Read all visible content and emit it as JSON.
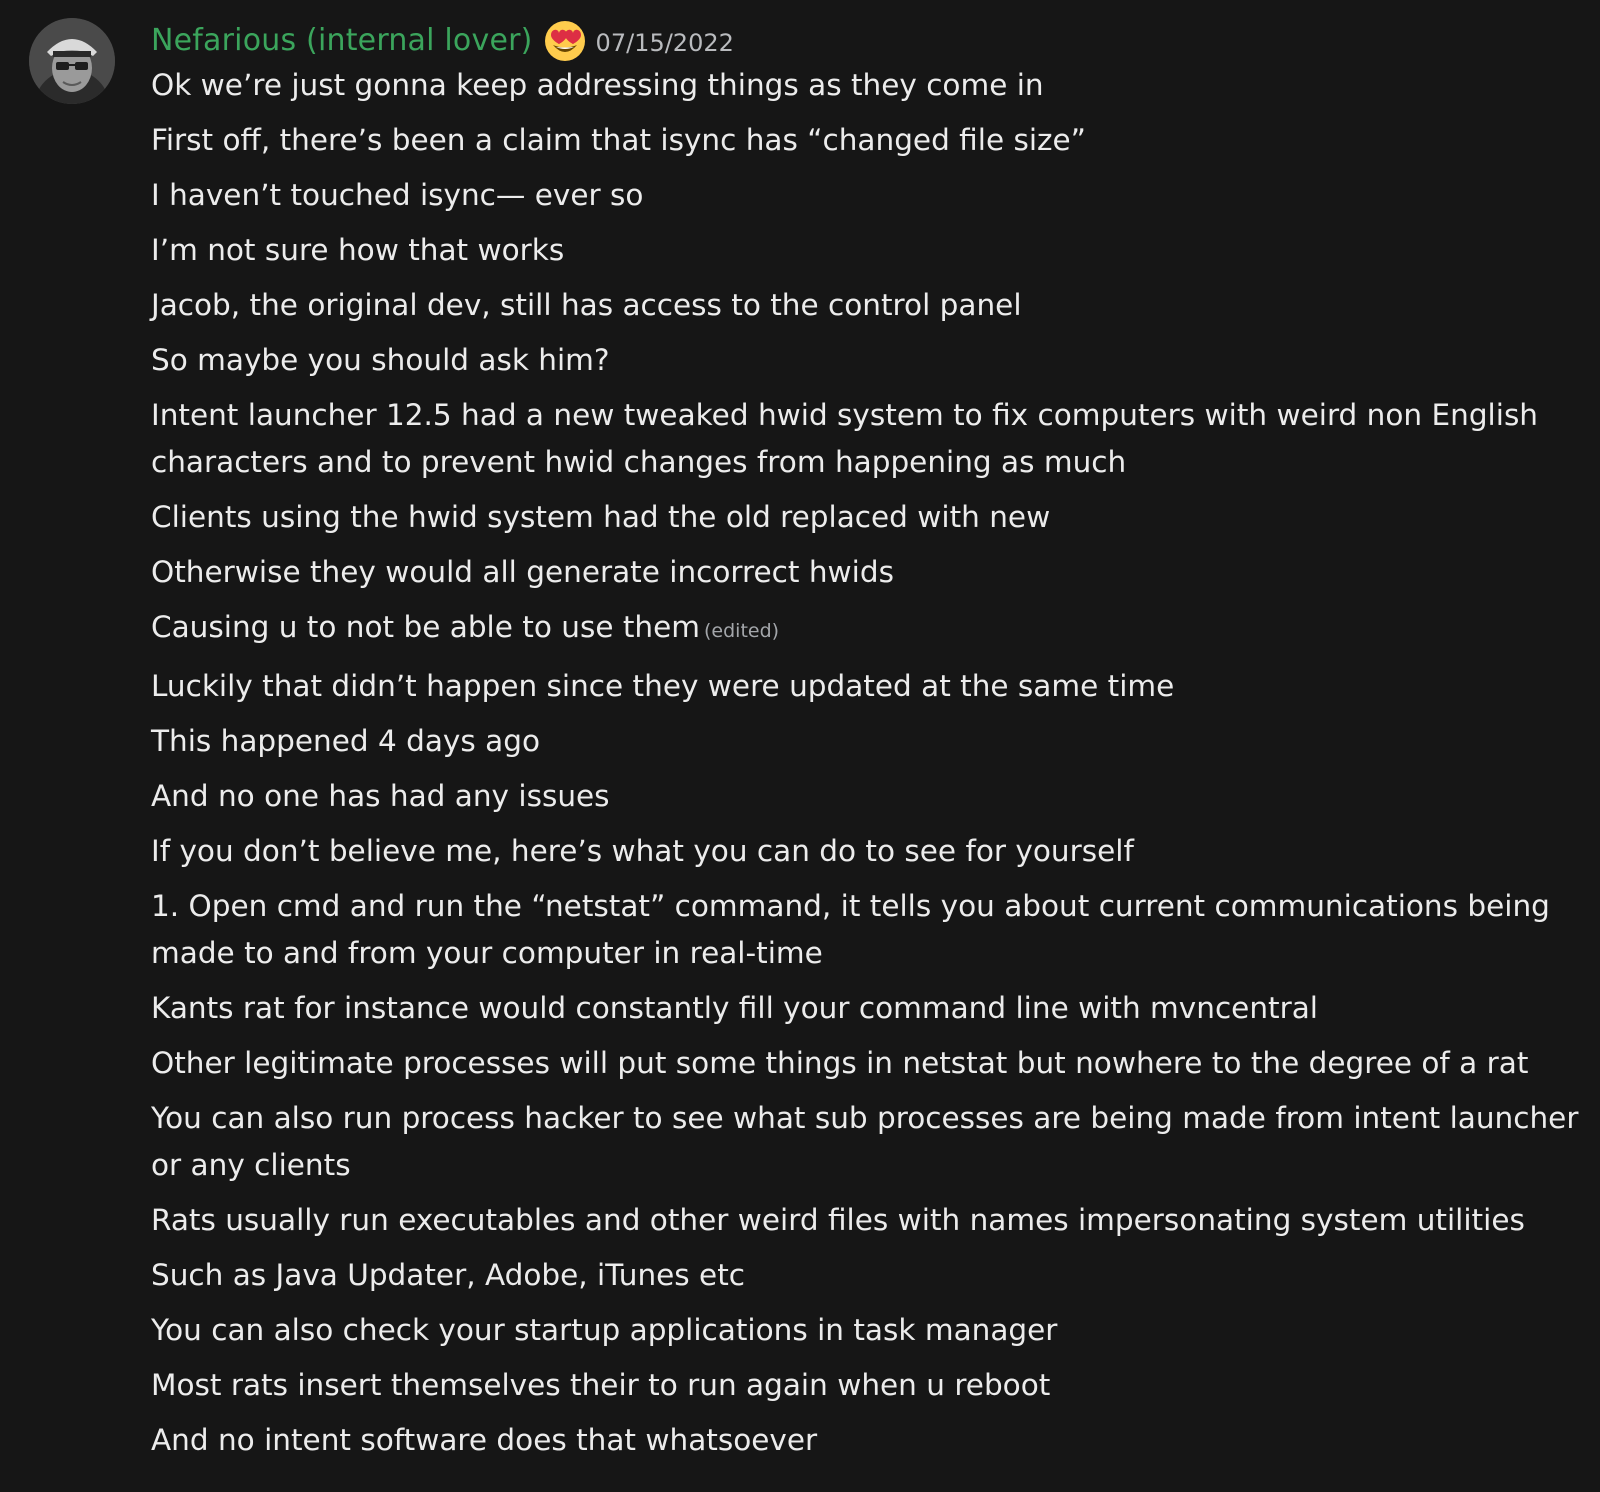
{
  "author": {
    "name": "Nefarious (internal lover)",
    "emoji": "heart-eyes-emoji",
    "timestamp": "07/15/2022",
    "name_color": "#3ba55c"
  },
  "edited_label": "(edited)",
  "messages": [
    {
      "text": "Ok we’re just gonna keep addressing things as they come in"
    },
    {
      "text": "First off, there’s been a claim that isync has “changed file size”"
    },
    {
      "text": "I haven’t touched isync— ever so"
    },
    {
      "text": "I’m not sure how that works"
    },
    {
      "text": "Jacob, the original dev, still has access to the control panel"
    },
    {
      "text": "So maybe you should ask him?"
    },
    {
      "text": "Intent launcher 12.5 had a new tweaked hwid system to fix computers with weird non English characters and to prevent hwid changes from happening as much"
    },
    {
      "text": "Clients using the hwid system had the old replaced with new"
    },
    {
      "text": "Otherwise they would all generate incorrect hwids"
    },
    {
      "text": "Causing u to not be able to use them",
      "edited": true
    },
    {
      "text": "Luckily that didn’t happen since they were updated at the same time"
    },
    {
      "text": "This happened 4 days ago"
    },
    {
      "text": "And no one has had any issues"
    },
    {
      "text": "If you don’t believe me, here’s what you can do to see for yourself"
    },
    {
      "text": "1. Open cmd and run the “netstat” command, it tells you about current communications being made to and from your computer in real-time"
    },
    {
      "text": "Kants rat for instance would constantly fill your command line with mvncentral"
    },
    {
      "text": "Other legitimate processes will put some things in netstat but nowhere to the degree of a rat"
    },
    {
      "text": "You can also run process hacker to see what sub processes are being made from intent launcher or any clients"
    },
    {
      "text": "Rats usually run executables and other weird files with names impersonating system utilities"
    },
    {
      "text": "Such as Java Updater, Adobe, iTunes etc"
    },
    {
      "text": "You can also check your startup applications in task manager"
    },
    {
      "text": "Most rats insert themselves their to run again when u reboot"
    },
    {
      "text": "And no intent software does that whatsoever"
    }
  ]
}
